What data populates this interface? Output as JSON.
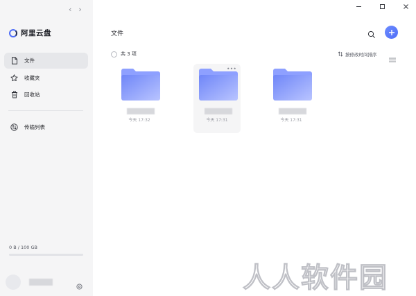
{
  "app": {
    "name": "阿里云盘"
  },
  "sidebar": {
    "items": [
      {
        "label": "文件",
        "icon": "file-icon",
        "active": true
      },
      {
        "label": "收藏夹",
        "icon": "star-icon",
        "active": false
      },
      {
        "label": "回收站",
        "icon": "trash-icon",
        "active": false
      },
      {
        "label": "传输列表",
        "icon": "transfer-icon",
        "active": false
      }
    ],
    "storage": {
      "text": "0 B / 100 GB",
      "used_fraction": 0
    }
  },
  "main": {
    "title": "文件",
    "select_all_label": "共 3 项",
    "sort_label": "按修改时间排序",
    "files": [
      {
        "time": "今天 17:32"
      },
      {
        "time": "今天 17:31"
      },
      {
        "time": "今天 17:31"
      }
    ]
  },
  "watermark": "人人软件园",
  "colors": {
    "accent": "#4f6ef7",
    "sidebar_bg": "#f5f5f6",
    "folder_light": "#b9c4ff",
    "folder_dark": "#6f86f8"
  }
}
